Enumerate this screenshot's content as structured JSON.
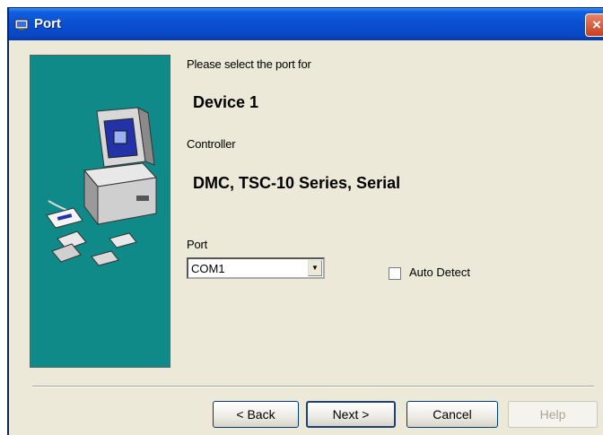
{
  "window": {
    "title": "Port",
    "close_label": "×"
  },
  "icons": {
    "title": "port-icon",
    "close": "close-icon",
    "banner": "computer-illustration"
  },
  "main": {
    "prompt": "Please select the port for",
    "device": "Device 1",
    "controller_label": "Controller",
    "controller_value": "DMC, TSC-10 Series, Serial",
    "port_label": "Port",
    "port_value": "COM1",
    "auto_detect_label": "Auto Detect",
    "auto_detect_checked": false
  },
  "buttons": {
    "back": "< Back",
    "next": "Next >",
    "cancel": "Cancel",
    "help": "Help"
  },
  "colors": {
    "titlebar": "#0a4fd0",
    "banner": "#0f8a88",
    "dialog_bg": "#ece9d8",
    "close": "#c8401f"
  }
}
